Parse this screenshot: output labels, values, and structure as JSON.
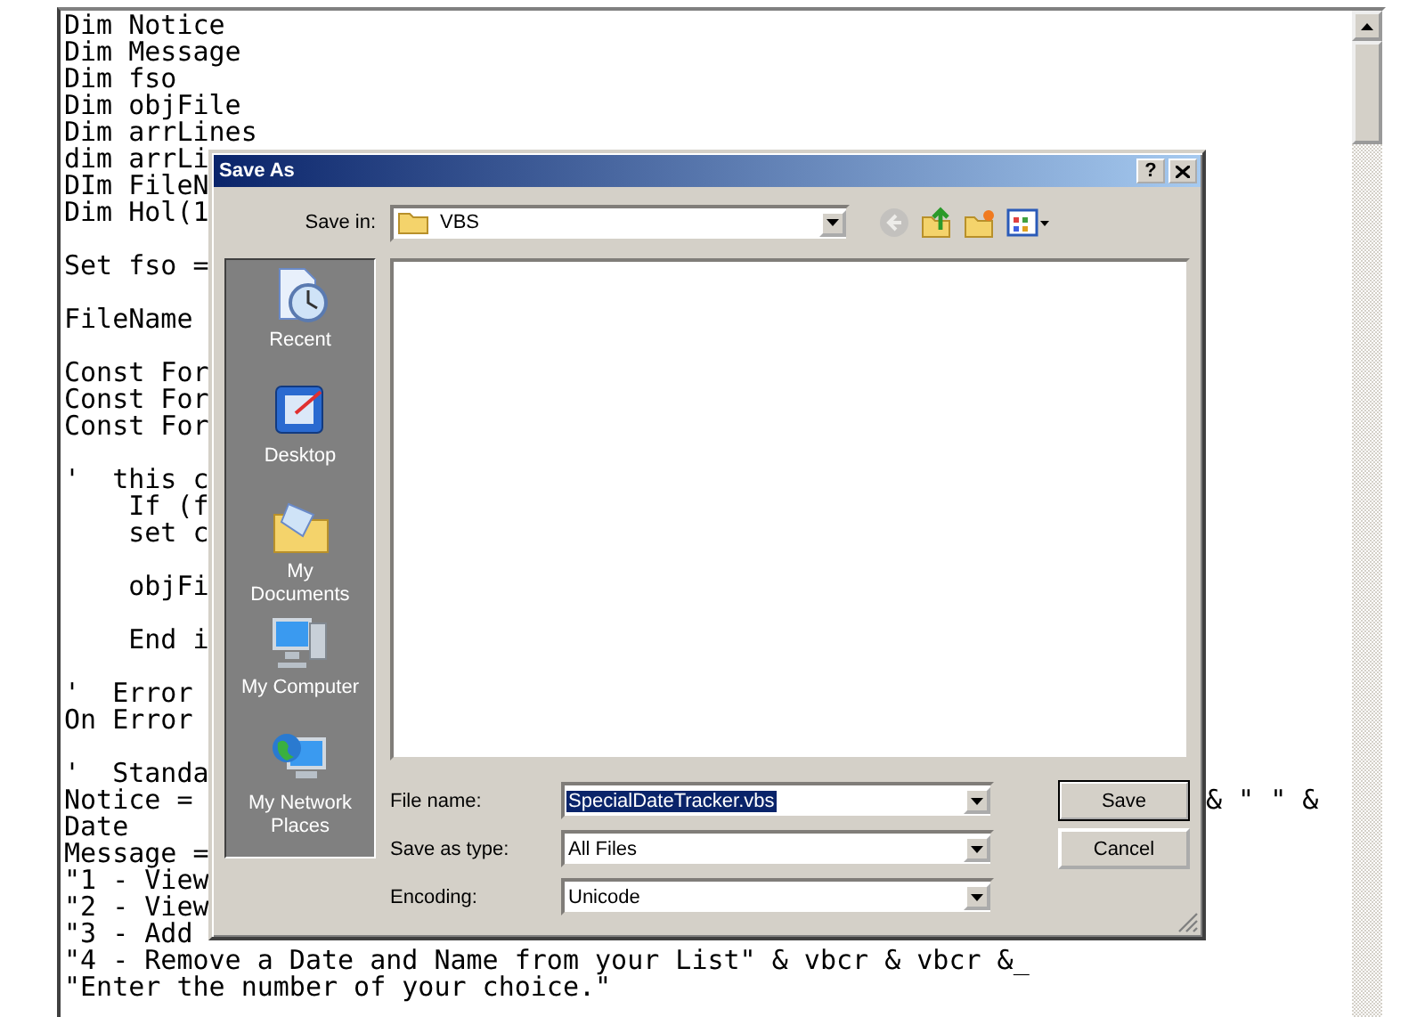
{
  "editor": {
    "lines": [
      {
        "kind": "code",
        "text": "Dim Notice"
      },
      {
        "kind": "code",
        "text": "Dim Message"
      },
      {
        "kind": "code",
        "text": "Dim fso"
      },
      {
        "kind": "code",
        "text": "Dim objFile"
      },
      {
        "kind": "code",
        "text": "Dim arrLines"
      },
      {
        "kind": "code",
        "text": "dim arrLi"
      },
      {
        "kind": "code",
        "text": "DIm FileN"
      },
      {
        "kind": "code",
        "text": "Dim Hol(1"
      },
      {
        "kind": "blank"
      },
      {
        "kind": "code",
        "text": "Set fso ="
      },
      {
        "kind": "blank"
      },
      {
        "kind": "code",
        "text": "FileName"
      },
      {
        "kind": "blank"
      },
      {
        "kind": "code",
        "text": "Const For"
      },
      {
        "kind": "code",
        "text": "Const For"
      },
      {
        "kind": "code",
        "text": "Const For"
      },
      {
        "kind": "blank"
      },
      {
        "kind": "code",
        "text": "'  this c"
      },
      {
        "kind": "code",
        "text": "    If (f"
      },
      {
        "kind": "code",
        "text": "    set c"
      },
      {
        "kind": "blank"
      },
      {
        "kind": "code",
        "text": "    objFi"
      },
      {
        "kind": "blank"
      },
      {
        "kind": "code",
        "text": "    End i"
      },
      {
        "kind": "blank"
      },
      {
        "kind": "code",
        "text": "'  Error"
      },
      {
        "kind": "code",
        "text": "On Error"
      },
      {
        "kind": "blank"
      },
      {
        "kind": "code",
        "text": "'  Standa"
      },
      {
        "kind": "code",
        "text": "Notice =",
        "tail": "& \" \" &"
      },
      {
        "kind": "code",
        "text": "Date"
      },
      {
        "kind": "code",
        "text": "Message ="
      },
      {
        "kind": "code",
        "text": "\"1 - View"
      },
      {
        "kind": "code",
        "text": "\"2 - View"
      },
      {
        "kind": "code",
        "text": "\"3 - Add"
      },
      {
        "kind": "code",
        "text": "\"4 - Remove a Date and Name from your List\" & vbcr & vbcr &_"
      },
      {
        "kind": "code",
        "text": "\"Enter the number of your choice.\""
      }
    ]
  },
  "dialog": {
    "title": "Save As",
    "help_button": "?",
    "save_in": {
      "label": "Save in:",
      "value": "VBS"
    },
    "toolbar": [
      {
        "kind": "back",
        "disabled": true
      },
      {
        "kind": "up",
        "disabled": false
      },
      {
        "kind": "new-folder",
        "disabled": false
      },
      {
        "kind": "views",
        "disabled": false
      }
    ],
    "places": [
      {
        "kind": "recent",
        "label": "Recent"
      },
      {
        "kind": "desktop",
        "label": "Desktop"
      },
      {
        "kind": "documents",
        "label": "My Documents"
      },
      {
        "kind": "computer",
        "label": "My Computer"
      },
      {
        "kind": "network",
        "label": "My Network Places"
      }
    ],
    "fields": [
      {
        "label": "File name:",
        "value": "SpecialDateTracker.vbs",
        "text_selected": true
      },
      {
        "label": "Save as type:",
        "value": "All Files",
        "text_selected": false
      },
      {
        "label": "Encoding:",
        "value": "Unicode",
        "text_selected": false
      }
    ],
    "buttons": [
      {
        "label": "Save",
        "default": true
      },
      {
        "label": "Cancel",
        "default": false
      }
    ]
  }
}
